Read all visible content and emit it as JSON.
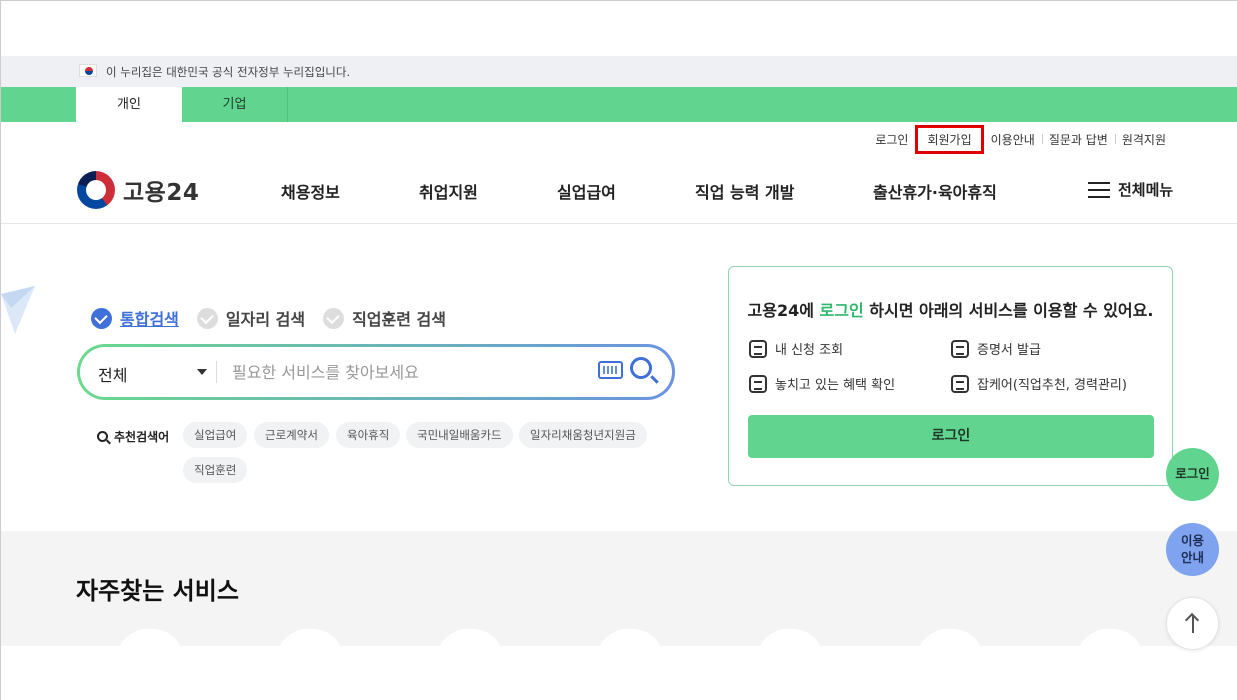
{
  "gov_banner": {
    "text": "이 누리집은 대한민국 공식 전자정부 누리집입니다."
  },
  "tabs": [
    {
      "label": "개인",
      "active": true
    },
    {
      "label": "기업",
      "active": false
    }
  ],
  "utility": [
    "로그인",
    "회원가입",
    "이용안내",
    "질문과 답변",
    "원격지원"
  ],
  "logo_text": "고용24",
  "gnb": [
    "채용정보",
    "취업지원",
    "실업급여",
    "직업 능력 개발",
    "출산휴가·육아휴직"
  ],
  "all_menu": "전체메뉴",
  "search": {
    "tabs": [
      "통합검색",
      "일자리 검색",
      "직업훈련 검색"
    ],
    "active_tab": 0,
    "select_value": "전체",
    "placeholder": "필요한 서비스를 찾아보세요"
  },
  "recommend": {
    "title": "추천검색어",
    "chips": [
      "실업급여",
      "근로계약서",
      "육아휴직",
      "국민내일배움카드",
      "일자리채움청년지원금",
      "직업훈련"
    ]
  },
  "login_box": {
    "title_pre": "고용24에 ",
    "title_highlight": "로그인",
    "title_post": " 하시면 아래의 서비스를 이용할 수 있어요.",
    "services": [
      "내 신청 조회",
      "증명서 발급",
      "놓치고 있는 혜택 확인",
      "잡케어(직업추천, 경력관리)"
    ],
    "button": "로그인"
  },
  "floating": {
    "login": "로그인",
    "guide": "이용\n안내"
  },
  "frequent": {
    "title": "자주찾는 서비스"
  },
  "colors": {
    "brand_green": "#61d48f",
    "accent_blue": "#3f6fd8",
    "highlight_red": "#e00000"
  }
}
